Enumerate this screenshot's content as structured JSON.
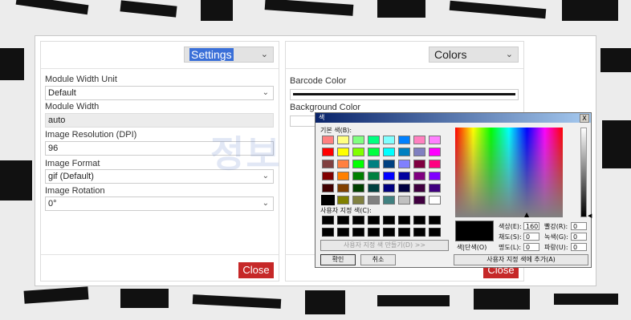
{
  "settings_panel": {
    "header_select": "Settings",
    "module_width_unit": {
      "label": "Module Width Unit",
      "value": "Default"
    },
    "module_width": {
      "label": "Module Width",
      "value": "auto"
    },
    "image_resolution": {
      "label": "Image Resolution (DPI)",
      "value": "96"
    },
    "image_format": {
      "label": "Image Format",
      "value": "gif (Default)"
    },
    "image_rotation": {
      "label": "Image Rotation",
      "value": "0°"
    },
    "close_label": "Close"
  },
  "colors_panel": {
    "header_select": "Colors",
    "barcode_color_label": "Barcode Color",
    "background_color_label": "Background Color",
    "close_label": "Close"
  },
  "color_dialog": {
    "title": "색",
    "close_glyph": "X",
    "basic_colors_label": "기본 색(B):",
    "custom_colors_label": "사용자 지정 색(C):",
    "define_custom_button": "사용자 지정 색 만들기(D) >>",
    "ok_button": "확인",
    "cancel_button": "취소",
    "preview_label": "색|단색(O)",
    "hue_label": "색상(E):",
    "hue_value": "160",
    "sat_label": "채도(S):",
    "sat_value": "0",
    "lum_label": "명도(L):",
    "lum_value": "0",
    "red_label": "빨강(R):",
    "red_value": "0",
    "green_label": "녹색(G):",
    "green_value": "0",
    "blue_label": "파랑(U):",
    "blue_value": "0",
    "add_custom_button": "사용자 지정 색에 추가(A)",
    "basic_colors": [
      "#ff8080",
      "#ffff80",
      "#80ff80",
      "#00ff80",
      "#80ffff",
      "#0080ff",
      "#ff80c0",
      "#ff80ff",
      "#ff0000",
      "#ffff00",
      "#80ff00",
      "#00ff40",
      "#00ffff",
      "#0080c0",
      "#8080c0",
      "#ff00ff",
      "#804040",
      "#ff8040",
      "#00ff00",
      "#008080",
      "#004080",
      "#8080ff",
      "#800040",
      "#ff0080",
      "#800000",
      "#ff8000",
      "#008000",
      "#008040",
      "#0000ff",
      "#0000a0",
      "#800080",
      "#8000ff",
      "#400000",
      "#804000",
      "#004000",
      "#004040",
      "#000080",
      "#000040",
      "#400040",
      "#400080",
      "#000000",
      "#808000",
      "#808040",
      "#808080",
      "#408080",
      "#c0c0c0",
      "#400040",
      "#ffffff"
    ]
  },
  "watermark_text": "정보"
}
